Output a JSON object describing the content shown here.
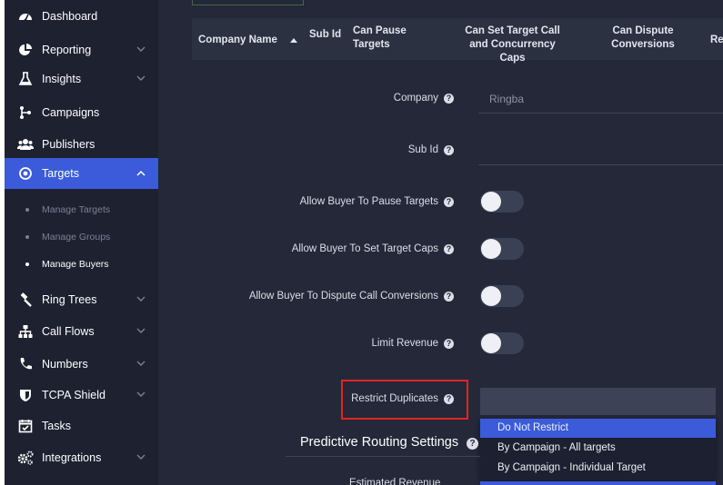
{
  "sidebar": {
    "items": [
      {
        "label": "Dashboard",
        "icon": "dashboard-icon"
      },
      {
        "label": "Reporting",
        "icon": "reporting-icon"
      },
      {
        "label": "Insights",
        "icon": "flask-icon"
      },
      {
        "label": "Campaigns",
        "icon": "branch-icon"
      },
      {
        "label": "Publishers",
        "icon": "users-icon"
      },
      {
        "label": "Targets",
        "icon": "target-icon"
      },
      {
        "label": "Ring Trees",
        "icon": "gavel-icon"
      },
      {
        "label": "Call Flows",
        "icon": "sitemap-icon"
      },
      {
        "label": "Numbers",
        "icon": "phone-icon"
      },
      {
        "label": "TCPA Shield",
        "icon": "shield-icon"
      },
      {
        "label": "Tasks",
        "icon": "calendar-check-icon"
      },
      {
        "label": "Integrations",
        "icon": "gears-icon"
      }
    ],
    "sub_items": [
      "Manage Targets",
      "Manage Groups",
      "Manage Buyers"
    ]
  },
  "table": {
    "headers": [
      "Company Name",
      "Sub Id",
      "Can Pause Targets",
      "Can Set Target Call and Concurrency Caps",
      "Can Dispute Conversions",
      "Re"
    ]
  },
  "form": {
    "company_label": "Company",
    "company_value": "Ringba",
    "subid_label": "Sub Id",
    "pause_label": "Allow Buyer To Pause Targets",
    "caps_label": "Allow Buyer To Set Target Caps",
    "dispute_label": "Allow Buyer To Dispute Call Conversions",
    "revenue_label": "Limit Revenue",
    "restrict_label": "Restrict Duplicates",
    "restrict_options": [
      "Do Not Restrict",
      "By Campaign - All targets",
      "By Campaign - Individual Target"
    ],
    "restrict_selected": "Do Not Restrict",
    "section_title": "Predictive Routing Settings",
    "bottom_label": "Estimated Revenue",
    "help_glyph": "?"
  },
  "colors": {
    "sidebar_bg": "#1e2130",
    "content_bg": "#242838",
    "accent": "#3b5bdb",
    "highlight": "#e02424"
  }
}
